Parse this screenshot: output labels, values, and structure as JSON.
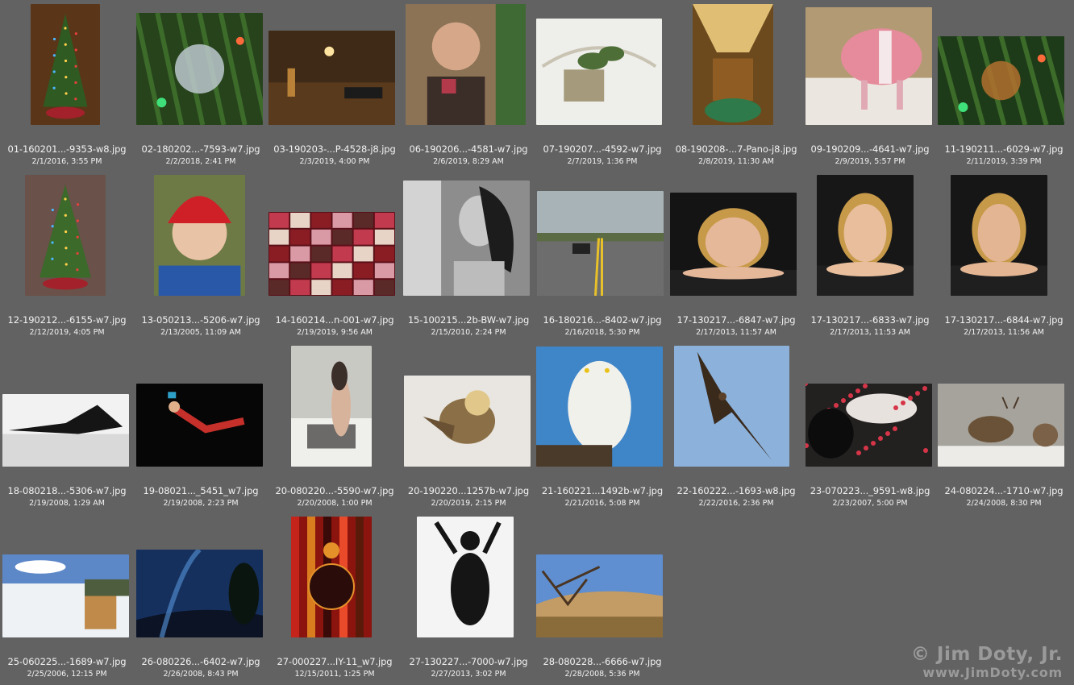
{
  "thumbnails": [
    {
      "filename": "01-160201...-9353-w8.jpg",
      "date": "2/1/2016, 3:55 PM",
      "kind": "xmas-tree",
      "bg": "#5a3518",
      "fg": "#2f5a22"
    },
    {
      "filename": "02-180202...-7593-w7.jpg",
      "date": "2/2/2018, 2:41 PM",
      "kind": "ornament",
      "bg": "#26431c",
      "fg": "#bcc8cc"
    },
    {
      "filename": "03-190203-...P-4528-j8.jpg",
      "date": "2/3/2019, 4:00 PM",
      "kind": "desk",
      "bg": "#3e2a16",
      "fg": "#b98238"
    },
    {
      "filename": "06-190206...-4581-w7.jpg",
      "date": "2/6/2019, 8:29 AM",
      "kind": "child",
      "bg": "#8c7356",
      "fg": "#d6a889"
    },
    {
      "filename": "07-190207...-4592-w7.jpg",
      "date": "2/7/2019, 1:36 PM",
      "kind": "sign",
      "bg": "#eeeeea",
      "fg": "#4d6e37"
    },
    {
      "filename": "08-190208-...7-Pano-j8.jpg",
      "date": "2/8/2019, 11:30 AM",
      "kind": "room",
      "bg": "#6c4a1e",
      "fg": "#d1a451"
    },
    {
      "filename": "09-190209...-4641-w7.jpg",
      "date": "2/9/2019, 5:57 PM",
      "kind": "pig",
      "bg": "#b29b74",
      "fg": "#e58b9b"
    },
    {
      "filename": "11-190211...-6029-w7.jpg",
      "date": "2/11/2019, 3:39 PM",
      "kind": "ornament",
      "bg": "#1d3b18",
      "fg": "#b2702e"
    },
    {
      "filename": "12-190212...-6155-w7.jpg",
      "date": "2/12/2019, 4:05 PM",
      "kind": "xmas-tree",
      "bg": "#6a5149",
      "fg": "#3b6a2a"
    },
    {
      "filename": "13-050213...-5206-w7.jpg",
      "date": "2/13/2005, 11:09 AM",
      "kind": "toddler",
      "bg": "#6d7a45",
      "fg": "#cf2028"
    },
    {
      "filename": "14-160214...n-001-w7.jpg",
      "date": "2/19/2019, 9:56 AM",
      "kind": "collage",
      "bg": "#5a1018",
      "fg": "#c23a4e"
    },
    {
      "filename": "15-100215...2b-BW-w7.jpg",
      "date": "2/15/2010, 2:24 PM",
      "kind": "bw-portrait",
      "bg": "#8d8d8d",
      "fg": "#1c1c1c"
    },
    {
      "filename": "16-180216...-8402-w7.jpg",
      "date": "2/16/2018, 5:30 PM",
      "kind": "road",
      "bg": "#a8b3b8",
      "fg": "#6b6b6b"
    },
    {
      "filename": "17-130217...-6847-w7.jpg",
      "date": "2/17/2013, 11:57 AM",
      "kind": "portrait",
      "bg": "#141414",
      "fg": "#e6b89a"
    },
    {
      "filename": "17-130217...-6833-w7.jpg",
      "date": "2/17/2013, 11:53 AM",
      "kind": "portrait",
      "bg": "#171717",
      "fg": "#e8be9c"
    },
    {
      "filename": "17-130217...-6844-w7.jpg",
      "date": "2/17/2013, 11:56 AM",
      "kind": "portrait",
      "bg": "#161616",
      "fg": "#e3b593"
    },
    {
      "filename": "18-080218...-5306-w7.jpg",
      "date": "2/19/2008, 1:29 AM",
      "kind": "bw-pose",
      "bg": "#f2f2f2",
      "fg": "#151515"
    },
    {
      "filename": "19-08021..._5451_w7.jpg",
      "date": "2/19/2008, 2:23 PM",
      "kind": "dancer",
      "bg": "#060606",
      "fg": "#c5302b"
    },
    {
      "filename": "20-080220...-5590-w7.jpg",
      "date": "2/20/2008, 1:00 PM",
      "kind": "snow-model",
      "bg": "#c9c9c4",
      "fg": "#3b2f2a"
    },
    {
      "filename": "20-190220...1257b-w7.jpg",
      "date": "2/20/2019, 2:15 PM",
      "kind": "bird",
      "bg": "#e9e6e1",
      "fg": "#8b6f46"
    },
    {
      "filename": "21-160221...1492b-w7.jpg",
      "date": "2/21/2016, 5:08 PM",
      "kind": "owl",
      "bg": "#3f86c9",
      "fg": "#f1f1ec"
    },
    {
      "filename": "22-160222...-1693-w8.jpg",
      "date": "2/22/2016, 2:36 PM",
      "kind": "eagle",
      "bg": "#8cb2dc",
      "fg": "#3a2a1c"
    },
    {
      "filename": "23-070223..._9591-w8.jpg",
      "date": "2/23/2007, 5:00 PM",
      "kind": "petals",
      "bg": "#232020",
      "fg": "#d63548"
    },
    {
      "filename": "24-080224...-1710-w7.jpg",
      "date": "2/24/2008, 8:30 PM",
      "kind": "elk",
      "bg": "#a6a39c",
      "fg": "#6a5238"
    },
    {
      "filename": "25-060225...-1689-w7.jpg",
      "date": "2/25/2006, 12:15 PM",
      "kind": "waterfall",
      "bg": "#5d88c8",
      "fg": "#eef2f4"
    },
    {
      "filename": "26-080226...-6402-w7.jpg",
      "date": "2/26/2008, 8:43 PM",
      "kind": "night",
      "bg": "#16305e",
      "fg": "#4d86c6"
    },
    {
      "filename": "27-000227...IY-11_w7.jpg",
      "date": "12/15/2011, 1:25 PM",
      "kind": "glass",
      "bg": "#8b140f",
      "fg": "#e5912a"
    },
    {
      "filename": "27-130227...-7000-w7.jpg",
      "date": "2/27/2013, 3:02 PM",
      "kind": "silhouette",
      "bg": "#f4f4f4",
      "fg": "#151515"
    },
    {
      "filename": "28-080228...-6666-w7.jpg",
      "date": "2/28/2008, 5:36 PM",
      "kind": "dunes",
      "bg": "#5f8fd0",
      "fg": "#c39b64"
    }
  ],
  "watermark": {
    "line1": "© Jim Doty, Jr.",
    "line2": "www.JimDoty.com"
  }
}
